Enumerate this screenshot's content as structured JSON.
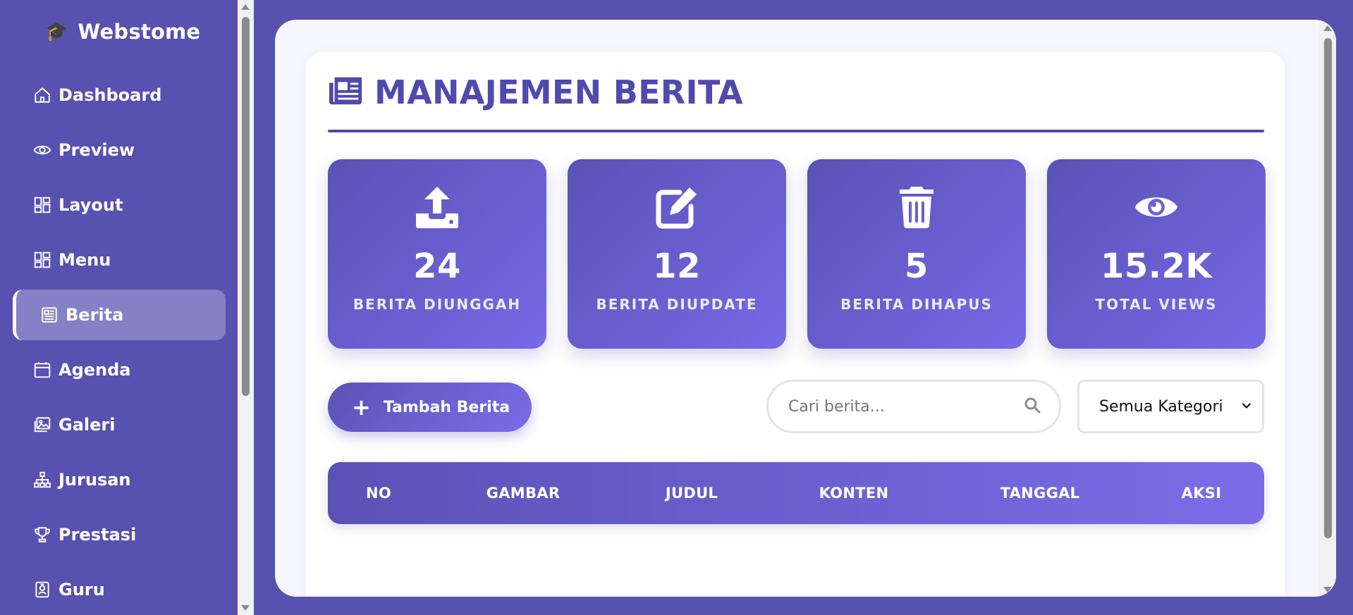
{
  "app": {
    "brand": "Webstome"
  },
  "sidebar": {
    "items": [
      {
        "label": "Dashboard",
        "icon": "home-icon",
        "active": false
      },
      {
        "label": "Preview",
        "icon": "eye-icon",
        "active": false
      },
      {
        "label": "Layout",
        "icon": "layout-icon",
        "active": false
      },
      {
        "label": "Menu",
        "icon": "layout-icon",
        "active": false
      },
      {
        "label": "Berita",
        "icon": "newspaper-icon",
        "active": true
      },
      {
        "label": "Agenda",
        "icon": "calendar-icon",
        "active": false
      },
      {
        "label": "Galeri",
        "icon": "images-icon",
        "active": false
      },
      {
        "label": "Jurusan",
        "icon": "sitemap-icon",
        "active": false
      },
      {
        "label": "Prestasi",
        "icon": "trophy-icon",
        "active": false
      },
      {
        "label": "Guru",
        "icon": "id-badge-icon",
        "active": false
      }
    ]
  },
  "page": {
    "title": "MANAJEMEN BERITA",
    "icon": "newspaper-icon"
  },
  "stats": [
    {
      "value": "24",
      "label": "BERITA DIUNGGAH",
      "icon": "upload-icon"
    },
    {
      "value": "12",
      "label": "BERITA DIUPDATE",
      "icon": "edit-icon"
    },
    {
      "value": "5",
      "label": "BERITA DIHAPUS",
      "icon": "trash-icon"
    },
    {
      "value": "15.2K",
      "label": "TOTAL VIEWS",
      "icon": "eye-icon"
    }
  ],
  "toolbar": {
    "add_label": "Tambah Berita",
    "search_placeholder": "Cari berita...",
    "category_selected": "Semua Kategori"
  },
  "table": {
    "columns": [
      "NO",
      "GAMBAR",
      "JUDUL",
      "KONTEN",
      "TANGGAL",
      "AKSI"
    ]
  },
  "colors": {
    "background": "#5751b0",
    "accent": "#5149ad",
    "gradient_start": "#5a52b5",
    "gradient_end": "#7c6ce8"
  }
}
